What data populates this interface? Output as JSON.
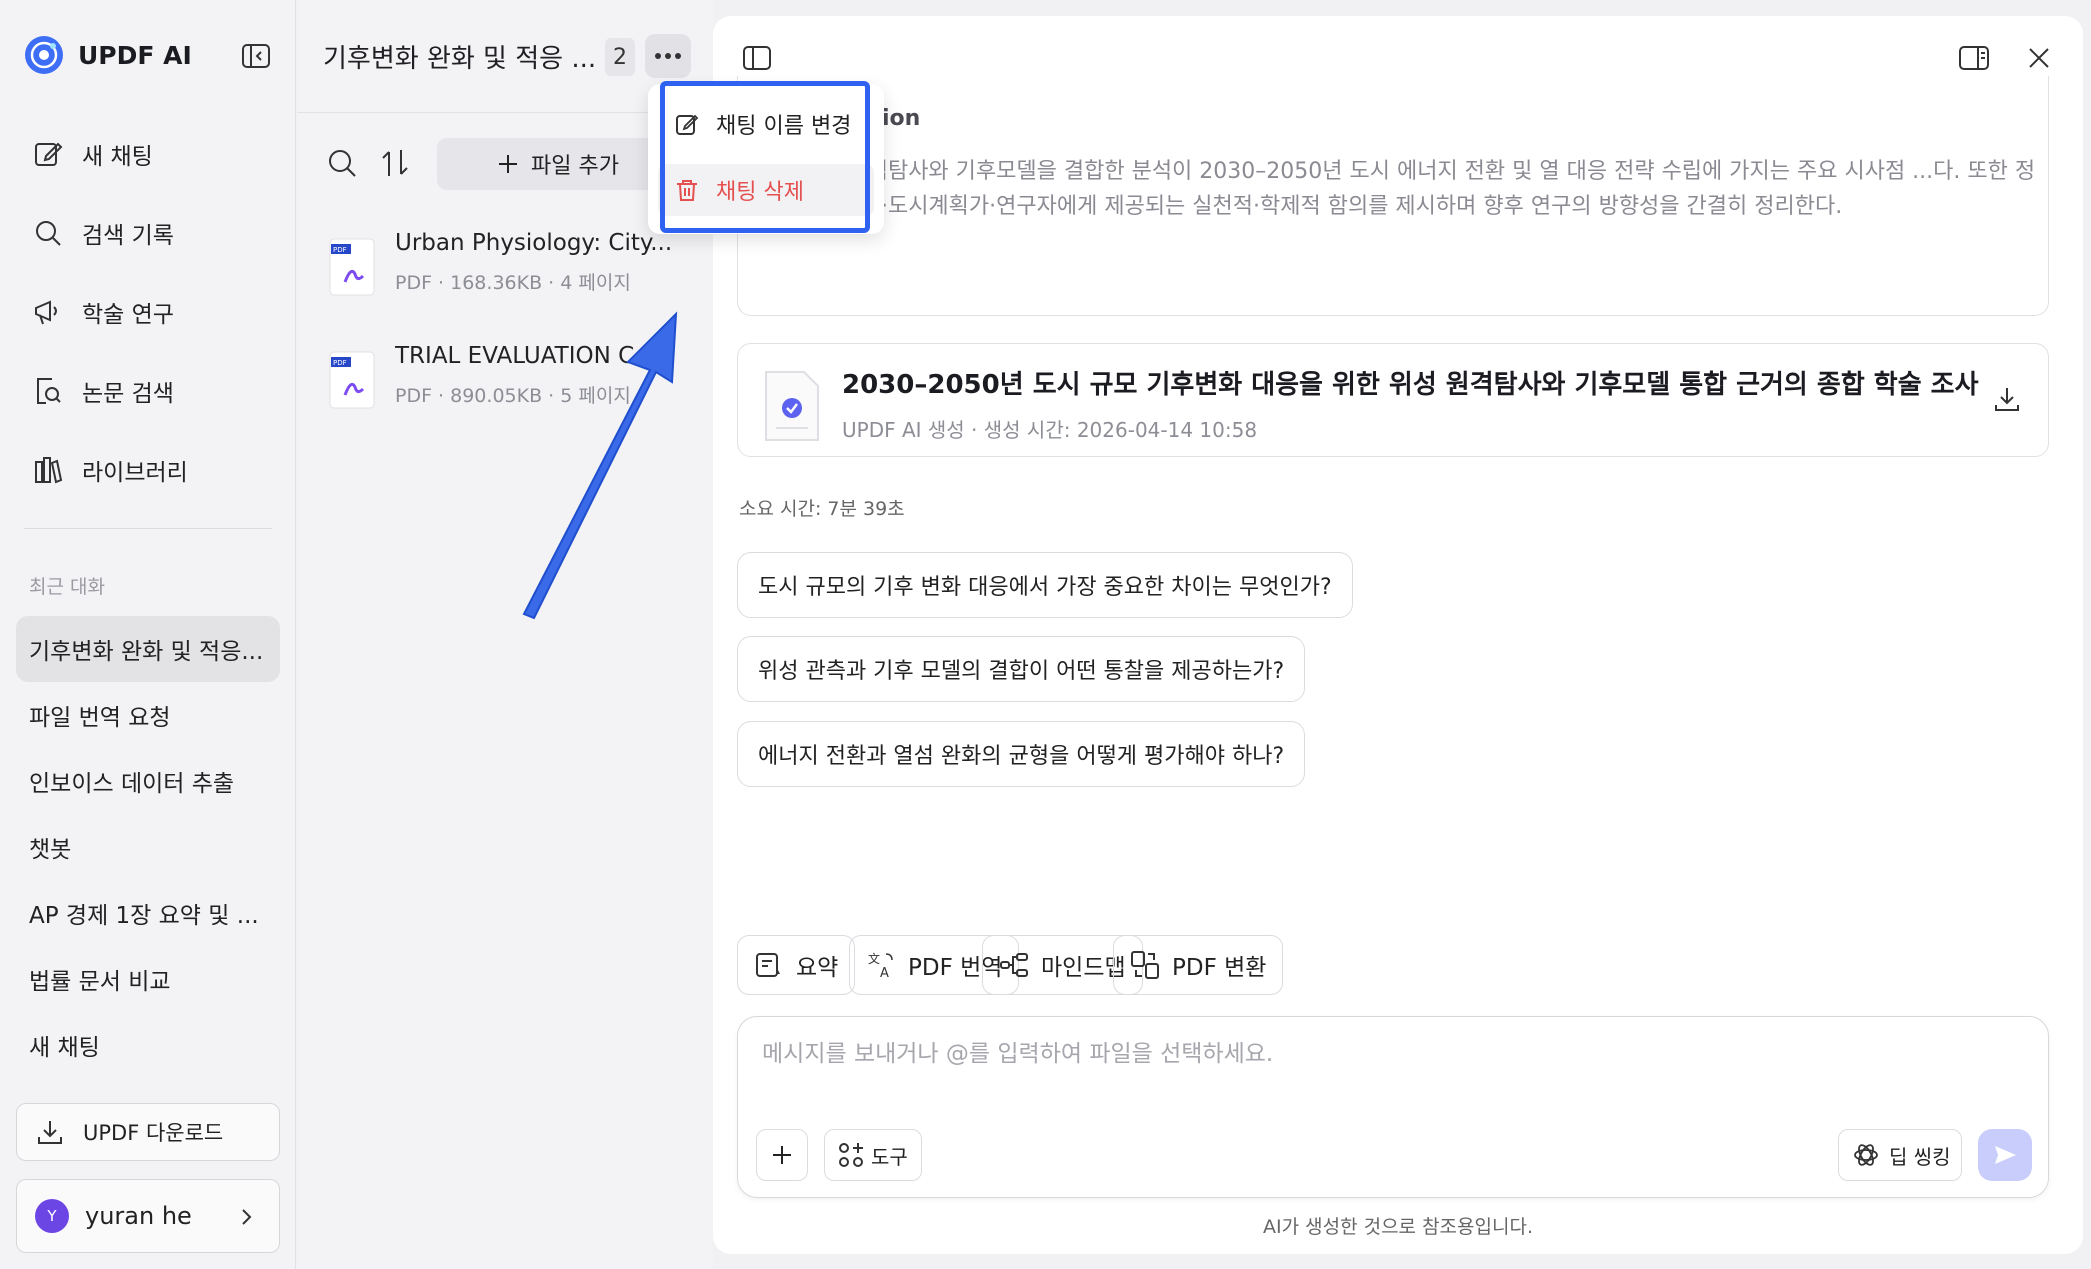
{
  "app": {
    "name": "UPDF AI"
  },
  "sidebar": {
    "nav": [
      {
        "label": "새 채팅",
        "icon": "new-chat-icon"
      },
      {
        "label": "검색 기록",
        "icon": "search-icon"
      },
      {
        "label": "학술 연구",
        "icon": "megaphone-icon"
      },
      {
        "label": "논문 검색",
        "icon": "paper-search-icon"
      },
      {
        "label": "라이브러리",
        "icon": "library-icon"
      }
    ],
    "recent_label": "최근 대화",
    "recent": [
      "기후변화 완화 및 적응...",
      "파일 번역 요청",
      "인보이스 데이터 추출",
      "챗봇",
      "AP 경제 1장 요약 및 ...",
      "법률 문서 비교",
      "새 채팅"
    ],
    "download_label": "UPDF 다운로드",
    "user": {
      "initial": "Y",
      "name": "yuran he"
    }
  },
  "middle": {
    "title": "기후변화 완화 및 적응 ...",
    "count": "2",
    "add_file_label": "파일 추가",
    "files": [
      {
        "name": "Urban Physiology: City...",
        "meta": "PDF · 168.36KB · 4 페이지"
      },
      {
        "name": "TRIAL EVALUATION C",
        "meta": "PDF · 890.05KB · 5 페이지"
      }
    ]
  },
  "menu": {
    "rename": "채팅 이름 변경",
    "delete": "채팅 삭제"
  },
  "main": {
    "summary_title": "ion",
    "summary_text": "위성 원격탐사와 기후모델을 결합한 분석이 2030–2050년 도시 에너지 전환 및 열 대응 전략 수립에 가지는 주요 시사점 ...다. 또한 정책입안자·도시계획가·연구자에게 제공되는 실천적·학제적 함의를 제시하며 향후 연구의 방향성을 간결히 정리한다.",
    "doc": {
      "title": "2030–2050년 도시 규모 기후변화 대응을 위한 위성 원격탐사와 기후모델 통합 근거의 종합 학술 조사",
      "meta": "UPDF AI 생성 · 생성 시간: 2026-04-14 10:58"
    },
    "elapsed": "소요 시간: 7분 39초",
    "suggestions": [
      "도시 규모의 기후 변화 대응에서 가장 중요한 차이는 무엇인가?",
      "위성 관측과 기후 모델의 결합이 어떤 통찰을 제공하는가?",
      "에너지 전환과 열섬 완화의 균형을 어떻게 평가해야 하나?"
    ],
    "tools": [
      "요약",
      "PDF 번역",
      "마인드맵",
      "PDF 변환"
    ],
    "composer": {
      "placeholder": "메시지를 보내거나 @를 입력하여 파일을 선택하세요.",
      "tools_label": "도구",
      "deep_label": "딥 씽킹"
    },
    "disclaimer": "AI가 생성한 것으로 참조용입니다."
  },
  "colors": {
    "accent": "#2f62f0",
    "danger": "#e44f4f",
    "send": "#c8cdfb"
  }
}
